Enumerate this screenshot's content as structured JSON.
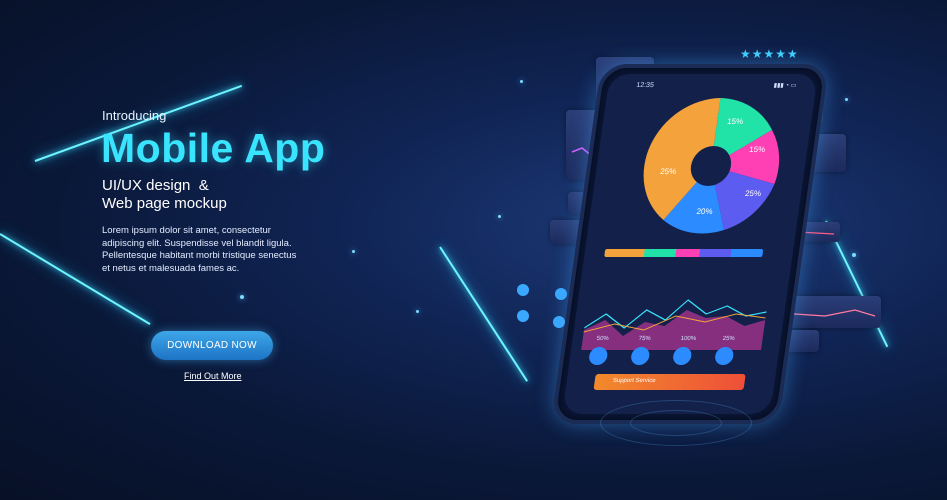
{
  "hero": {
    "intro": "Introducing",
    "title": "Mobile App",
    "subtitle_line1": "UI/UX design  &",
    "subtitle_line2": "Web page mockup",
    "body": "Lorem ipsum dolor sit amet, consectetur adipiscing elit. Suspendisse vel blandit ligula. Pellentesque habitant morbi tristique senectus et netus et malesuada fames ac."
  },
  "actions": {
    "download": "DOWNLOAD NOW",
    "find_out_more": "Find Out More"
  },
  "phone": {
    "time": "12:35",
    "donut_labels": [
      "15%",
      "15%",
      "25%",
      "25%",
      "20%"
    ],
    "stat_percents": [
      "50%",
      "75%",
      "100%",
      "25%"
    ],
    "support_label": "Support Service"
  },
  "rating": {
    "stars": "★★★★★"
  },
  "colors": {
    "accent": "#39e4ff",
    "donut": [
      "#21e3a8",
      "#ff3fb4",
      "#5d5cf0",
      "#2c8cff",
      "#f4a23b"
    ]
  }
}
